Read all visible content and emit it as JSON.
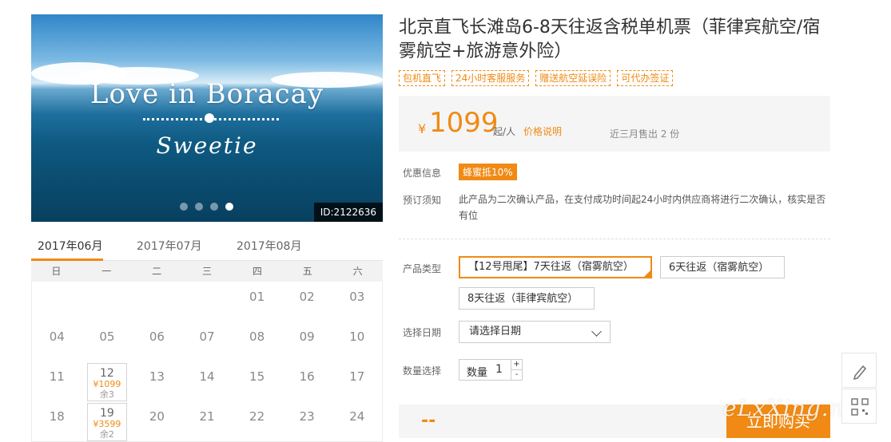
{
  "hero": {
    "slogan": "Love in Boracay",
    "script_text": "Sweetie",
    "id_badge": "ID:2122636",
    "active_slide": 4,
    "slide_count": 4
  },
  "calendar": {
    "months": [
      "2017年06月",
      "2017年07月",
      "2017年08月"
    ],
    "weekdays": [
      "日",
      "一",
      "二",
      "三",
      "四",
      "五",
      "六"
    ],
    "weeks": [
      [
        {
          "d": ""
        },
        {
          "d": ""
        },
        {
          "d": ""
        },
        {
          "d": ""
        },
        {
          "d": "01"
        },
        {
          "d": "02"
        },
        {
          "d": "03"
        }
      ],
      [
        {
          "d": "04"
        },
        {
          "d": "05"
        },
        {
          "d": "06"
        },
        {
          "d": "07"
        },
        {
          "d": "08"
        },
        {
          "d": "09"
        },
        {
          "d": "10"
        }
      ],
      [
        {
          "d": "11"
        },
        {
          "d": "12",
          "price": "¥1099",
          "remain": "余3"
        },
        {
          "d": "13"
        },
        {
          "d": "14"
        },
        {
          "d": "15"
        },
        {
          "d": "16"
        },
        {
          "d": "17"
        }
      ],
      [
        {
          "d": "18"
        },
        {
          "d": "19",
          "price": "¥3599",
          "remain": "余2"
        },
        {
          "d": "20"
        },
        {
          "d": "21"
        },
        {
          "d": "22"
        },
        {
          "d": "23"
        },
        {
          "d": "24"
        }
      ]
    ]
  },
  "product": {
    "title": "北京直飞长滩岛6-8天往返含税单机票（菲律宾航空/宿雾航空+旅游意外险）",
    "tags": [
      "包机直飞",
      "24小时客服服务",
      "赠送航空延误险",
      "可代办签证"
    ],
    "currency": "¥",
    "price": "1099",
    "per": "起/人",
    "price_note": "价格说明",
    "sold": "近三月售出 2 份"
  },
  "labels": {
    "promo": "优惠信息",
    "notice": "预订须知",
    "type": "产品类型",
    "date": "选择日期",
    "qty": "数量选择"
  },
  "promo_badge": "蜂蜜抵10%",
  "notice_text": "此产品为二次确认产品，在支付成功时间起24小时内供应商将进行二次确认，核实是否有位",
  "options": [
    "【12号甩尾】7天往返（宿雾航空）",
    "6天往返（宿雾航空）",
    "8天往返（菲律宾航空）"
  ],
  "date_select": {
    "placeholder": "请选择日期"
  },
  "quantity": {
    "label": "数量",
    "value": "1",
    "plus": "+",
    "minus": "-"
  },
  "bottom": {
    "total": "--",
    "buy": "立即购买"
  },
  "watermark": "eLxXing.net",
  "colors": {
    "accent": "#f08a14"
  }
}
